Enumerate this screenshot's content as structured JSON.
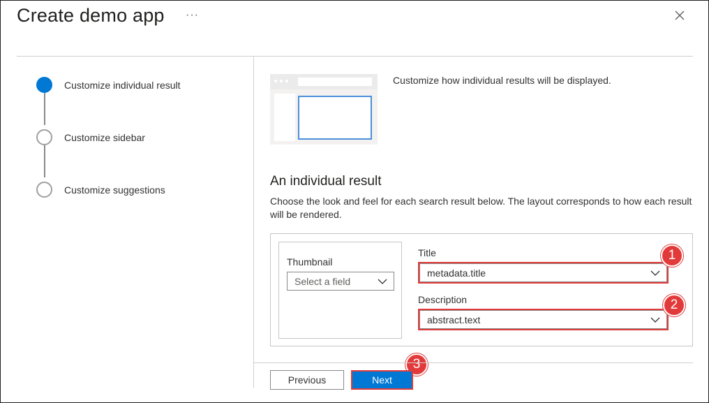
{
  "dialog": {
    "title": "Create demo app",
    "more_label": "···",
    "close_icon": "close-icon"
  },
  "steps": [
    {
      "label": "Customize individual result",
      "state": "active"
    },
    {
      "label": "Customize sidebar",
      "state": "inactive"
    },
    {
      "label": "Customize suggestions",
      "state": "inactive"
    }
  ],
  "content": {
    "intro": "Customize how individual results will be displayed.",
    "section_title": "An individual result",
    "section_desc": "Choose the look and feel for each search result below. The layout corresponds to how each result will be rendered.",
    "thumbnail": {
      "label": "Thumbnail",
      "placeholder": "Select a field"
    },
    "title_field": {
      "label": "Title",
      "value": "metadata.title"
    },
    "description_field": {
      "label": "Description",
      "value": "abstract.text"
    }
  },
  "callouts": [
    "1",
    "2",
    "3"
  ],
  "footer": {
    "previous_label": "Previous",
    "next_label": "Next"
  },
  "colors": {
    "accent": "#0078d4",
    "callout": "#e23a3a"
  }
}
